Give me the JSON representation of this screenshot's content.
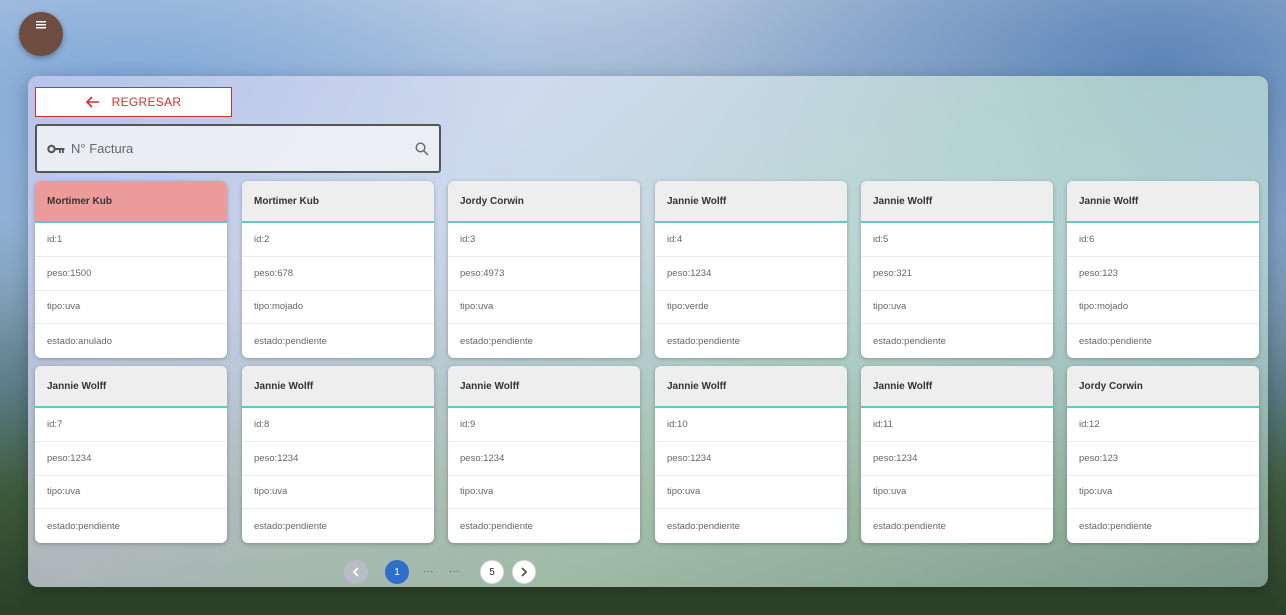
{
  "back_button": {
    "label": "REGRESAR"
  },
  "search": {
    "placeholder": "N° Factura"
  },
  "cards": [
    {
      "name": "Mortimer Kub",
      "id": "id:1",
      "peso": "peso:1500",
      "tipo": "tipo:uva",
      "estado": "estado:anulado",
      "selected": true
    },
    {
      "name": "Mortimer Kub",
      "id": "id:2",
      "peso": "peso:678",
      "tipo": "tipo:mojado",
      "estado": "estado:pendiente"
    },
    {
      "name": "Jordy Corwin",
      "id": "id:3",
      "peso": "peso:4973",
      "tipo": "tipo:uva",
      "estado": "estado:pendiente"
    },
    {
      "name": "Jannie Wolff",
      "id": "id:4",
      "peso": "peso:1234",
      "tipo": "tipo:verde",
      "estado": "estado:pendiente"
    },
    {
      "name": "Jannie Wolff",
      "id": "id:5",
      "peso": "peso:321",
      "tipo": "tipo:uva",
      "estado": "estado:pendiente"
    },
    {
      "name": "Jannie Wolff",
      "id": "id:6",
      "peso": "peso:123",
      "tipo": "tipo:mojado",
      "estado": "estado:pendiente"
    },
    {
      "name": "Jannie Wolff",
      "id": "id:7",
      "peso": "peso:1234",
      "tipo": "tipo:uva",
      "estado": "estado:pendiente"
    },
    {
      "name": "Jannie Wolff",
      "id": "id:8",
      "peso": "peso:1234",
      "tipo": "tipo:uva",
      "estado": "estado:pendiente"
    },
    {
      "name": "Jannie Wolff",
      "id": "id:9",
      "peso": "peso:1234",
      "tipo": "tipo:uva",
      "estado": "estado:pendiente"
    },
    {
      "name": "Jannie Wolff",
      "id": "id:10",
      "peso": "peso:1234",
      "tipo": "tipo:uva",
      "estado": "estado:pendiente"
    },
    {
      "name": "Jannie Wolff",
      "id": "id:11",
      "peso": "peso:1234",
      "tipo": "tipo:uva",
      "estado": "estado:pendiente"
    },
    {
      "name": "Jordy Corwin",
      "id": "id:12",
      "peso": "peso:123",
      "tipo": "tipo:uva",
      "estado": "estado:pendiente"
    }
  ],
  "pagination": {
    "current": "1",
    "last": "5",
    "ellipsis": "..."
  },
  "colors": {
    "accent_red": "#d32f2f",
    "selected_header": "#ec9a9a",
    "header_rule": "#63c8c4",
    "page_active": "#2e6fcb"
  },
  "icons": {
    "menu": "menu-icon",
    "back": "arrow-left-icon",
    "key": "key-icon",
    "search": "search-icon",
    "prev": "chevron-left-icon",
    "next": "chevron-right-icon"
  }
}
